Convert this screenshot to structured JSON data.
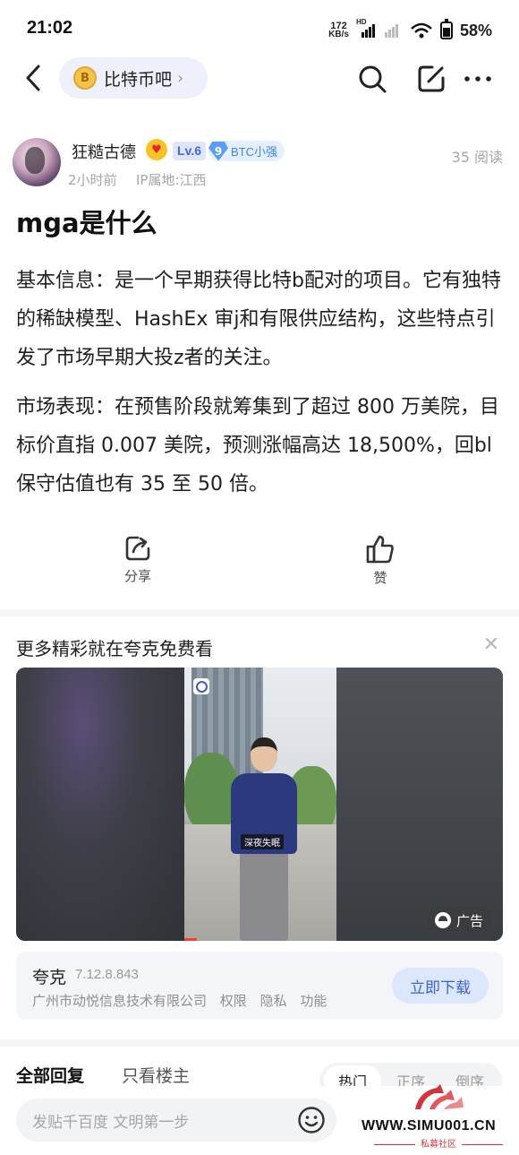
{
  "status_bar": {
    "time": "21:02",
    "net_speed_value": "172",
    "net_speed_unit": "KB/s",
    "hd_label": "HD",
    "battery": "58%"
  },
  "header": {
    "forum_name": "比特币吧",
    "forum_icon": "bitcoin-coin",
    "icons": [
      "back-icon",
      "search-icon",
      "share-edit-icon",
      "more-icon"
    ]
  },
  "author": {
    "name": "狂糙古德",
    "level": "Lv.6",
    "badge_level": "9",
    "badge_name": "BTC小强",
    "time_ago": "2小时前",
    "ip_location": "IP属地:江西",
    "views": "35 阅读"
  },
  "post": {
    "title": "mga是什么",
    "paragraphs": [
      "基本信息：是一个早期获得比特b配对的项目。它有独特的稀缺模型、HashEx 审j和有限供应结构，这些特点引发了市场早期大投z者的关注。",
      "市场表现：在预售阶段就筹集到了超过 800 万美院，目标价直指 0.007 美院，预测涨幅高达 18,500%，回bl保守估值也有 35 至 50 倍。"
    ],
    "share_label": "分享",
    "like_label": "赞"
  },
  "ad": {
    "title": "更多精彩就在夸克免费看",
    "video_caption": "深夜失眠",
    "tag": "广告",
    "app_name": "夸克",
    "app_version": "7.12.8.843",
    "developer": "广州市动悦信息技术有限公司",
    "links": [
      "权限",
      "隐私",
      "功能"
    ],
    "download_label": "立即下载",
    "video_progress": 0.08
  },
  "replies": {
    "tab_all": "全部回复",
    "tab_op": "只看楼主",
    "sort_options": [
      "热门",
      "正序",
      "倒序"
    ],
    "sort_active": "热门"
  },
  "bottom_bar": {
    "reply_placeholder": "发贴千百度 文明第一步"
  },
  "watermark": {
    "site": "WWW.SIMU001.CN",
    "sub": "私募社区"
  },
  "colors": {
    "accent_blue": "#3b63d6",
    "badge_blue": "#4966d8",
    "muted": "#a6a6a6",
    "watermark_red": "#d2343b"
  }
}
